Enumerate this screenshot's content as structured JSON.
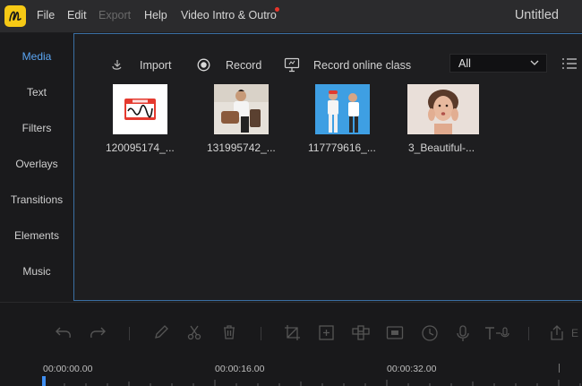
{
  "menubar": {
    "items": [
      "File",
      "Edit",
      "Export",
      "Help",
      "Video Intro & Outro"
    ],
    "title": "Untitled",
    "accent_color": "#f6c915",
    "notification_color": "#e8352b"
  },
  "sidebar": {
    "items": [
      "Media",
      "Text",
      "Filters",
      "Overlays",
      "Transitions",
      "Elements",
      "Music"
    ],
    "active_color": "#5aa5f2"
  },
  "media": {
    "toolbar": {
      "import_label": "Import",
      "record_label": "Record",
      "record_online_label": "Record online class"
    },
    "filter": {
      "selected": "All"
    },
    "items": [
      {
        "label": "120095174_...",
        "thumb": "hello-sticker-image"
      },
      {
        "label": "131995742_...",
        "thumb": "person-on-chair-photo"
      },
      {
        "label": "117779616_...",
        "thumb": "two-people-blue-sky-photo"
      },
      {
        "label": "3_Beautiful-...",
        "thumb": "woman-portrait-photo"
      }
    ]
  },
  "timeline": {
    "timecodes": [
      "00:00:00.00",
      "00:00:16.00",
      "00:00:32.00"
    ],
    "playhead_color": "#3f8ef0"
  }
}
